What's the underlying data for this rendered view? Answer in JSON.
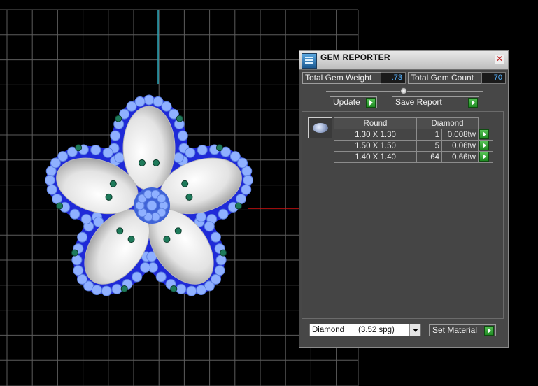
{
  "panel": {
    "title": "GEM REPORTER",
    "total_gem_weight_label": "Total Gem Weight",
    "total_gem_weight": ".73",
    "total_gem_count_label": "Total Gem Count",
    "total_gem_count": "70",
    "update_label": "Update",
    "save_report_label": "Save Report",
    "table": {
      "headers": [
        "Round",
        "Diamond"
      ],
      "rows": [
        {
          "size": "1.30 X 1.30",
          "count": "1",
          "weight": "0.008tw"
        },
        {
          "size": "1.50 X 1.50",
          "count": "5",
          "weight": "0.06tw"
        },
        {
          "size": "1.40 X 1.40",
          "count": "64",
          "weight": "0.66tw"
        }
      ]
    },
    "material": {
      "name": "Diamond",
      "spg": "(3.52 spg)"
    },
    "set_material_label": "Set Material"
  },
  "colors": {
    "background": "#000000",
    "grid": "#5c5c5c",
    "panel": "#474747",
    "value_text": "#58b4ff",
    "axis_vertical": "#2aa6b8",
    "axis_horizontal": "#d01010",
    "bezel": "#1f2ad8",
    "small_gem": "#8fb0ff",
    "prong": "#1e7a5a"
  }
}
